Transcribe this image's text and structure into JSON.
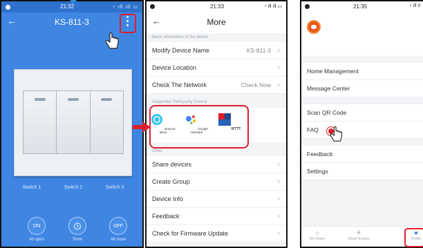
{
  "phone1": {
    "time": "21:32",
    "title": "KS-811-3",
    "switches": [
      "Switch 1",
      "Switch 2",
      "Switch 3"
    ],
    "controls": [
      {
        "icon": "ON",
        "label": "All open"
      },
      {
        "icon": "clock-icon",
        "label": "Timer"
      },
      {
        "icon": "OFF",
        "label": "All close"
      }
    ]
  },
  "phone2": {
    "time": "21:33",
    "title": "More",
    "section_basic": "Basic information of the device",
    "rows_basic": [
      {
        "label": "Modify Device Name",
        "value": "KS-811-3"
      },
      {
        "label": "Device Location",
        "value": ""
      },
      {
        "label": "Check The Network",
        "value": "Check Now"
      }
    ],
    "section_third": "Supported Third-party Control",
    "third_party": [
      {
        "name": "amazon alexa",
        "color": "#31c4f3"
      },
      {
        "name": "Google Assistant",
        "color": "#4285f4"
      },
      {
        "name": "IFTTT",
        "color": "#1c4a8c"
      }
    ],
    "section_other": "Other",
    "rows_other": [
      {
        "label": "Share devices"
      },
      {
        "label": "Create Group"
      },
      {
        "label": "Device Info"
      },
      {
        "label": "Feedback"
      },
      {
        "label": "Check for Firmware Update"
      }
    ]
  },
  "phone3": {
    "time": "21:35",
    "menu_a": [
      "Home Management",
      "Message Center"
    ],
    "menu_b": [
      "Scan QR Code",
      "FAQ"
    ],
    "menu_c": [
      "Feedback",
      "Settings"
    ],
    "tabs": [
      {
        "label": "My Home",
        "icon": "home-icon"
      },
      {
        "label": "Smart Scenes",
        "icon": "sun-icon"
      },
      {
        "label": "Profile",
        "icon": "person-icon"
      }
    ]
  },
  "colors": {
    "accent": "#3f86e3",
    "highlight": "#e01e2d"
  }
}
